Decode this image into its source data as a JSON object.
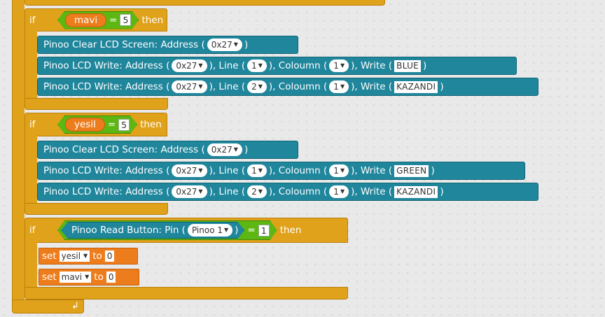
{
  "script": {
    "if_keyword": "if",
    "then_keyword": "then",
    "equals_symbol": "=",
    "if_blocks": [
      {
        "condition": {
          "variable": "mavi",
          "value": "5"
        },
        "commands": [
          {
            "text": "Pinoo Clear LCD Screen: Address (",
            "address": "0x27",
            "close": ")"
          },
          {
            "text": "Pinoo LCD Write: Address (",
            "address": "0x27",
            "line_label": "), Line (",
            "line": "1",
            "col_label": "), Coloumn (",
            "col": "1",
            "write_label": "), Write (",
            "write": "BLUE",
            "close": ")"
          },
          {
            "text": "Pinoo LCD Write: Address (",
            "address": "0x27",
            "line_label": "), Line (",
            "line": "2",
            "col_label": "), Coloumn (",
            "col": "1",
            "write_label": "), Write (",
            "write": "KAZANDI",
            "close": ")"
          }
        ]
      },
      {
        "condition": {
          "variable": "yesil",
          "value": "5"
        },
        "commands": [
          {
            "text": "Pinoo Clear LCD Screen: Address (",
            "address": "0x27",
            "close": ")"
          },
          {
            "text": "Pinoo LCD Write: Address (",
            "address": "0x27",
            "line_label": "), Line (",
            "line": "1",
            "col_label": "), Coloumn (",
            "col": "1",
            "write_label": "), Write (",
            "write": "GREEN",
            "close": ")"
          },
          {
            "text": "Pinoo LCD Write: Address (",
            "address": "0x27",
            "line_label": "), Line (",
            "line": "2",
            "col_label": "), Coloumn (",
            "col": "1",
            "write_label": "), Write (",
            "write": "KAZANDI",
            "close": ")"
          }
        ]
      },
      {
        "condition": {
          "reporter_text": "Pinoo Read Button: Pin (",
          "pin": "Pinoo 1",
          "close": ")",
          "value": "1"
        },
        "set_blocks": [
          {
            "set_label": "set",
            "variable": "yesil",
            "to_label": "to",
            "value": "0"
          },
          {
            "set_label": "set",
            "variable": "mavi",
            "to_label": "to",
            "value": "0"
          }
        ]
      }
    ],
    "loop_arrow_icon": "loop-arrow-icon"
  },
  "colors": {
    "control": "#e0a21a",
    "operator": "#5cb712",
    "variable": "#ed7d1c",
    "pinoo_extension": "#20869c",
    "workspace": "#e9e9ea"
  }
}
